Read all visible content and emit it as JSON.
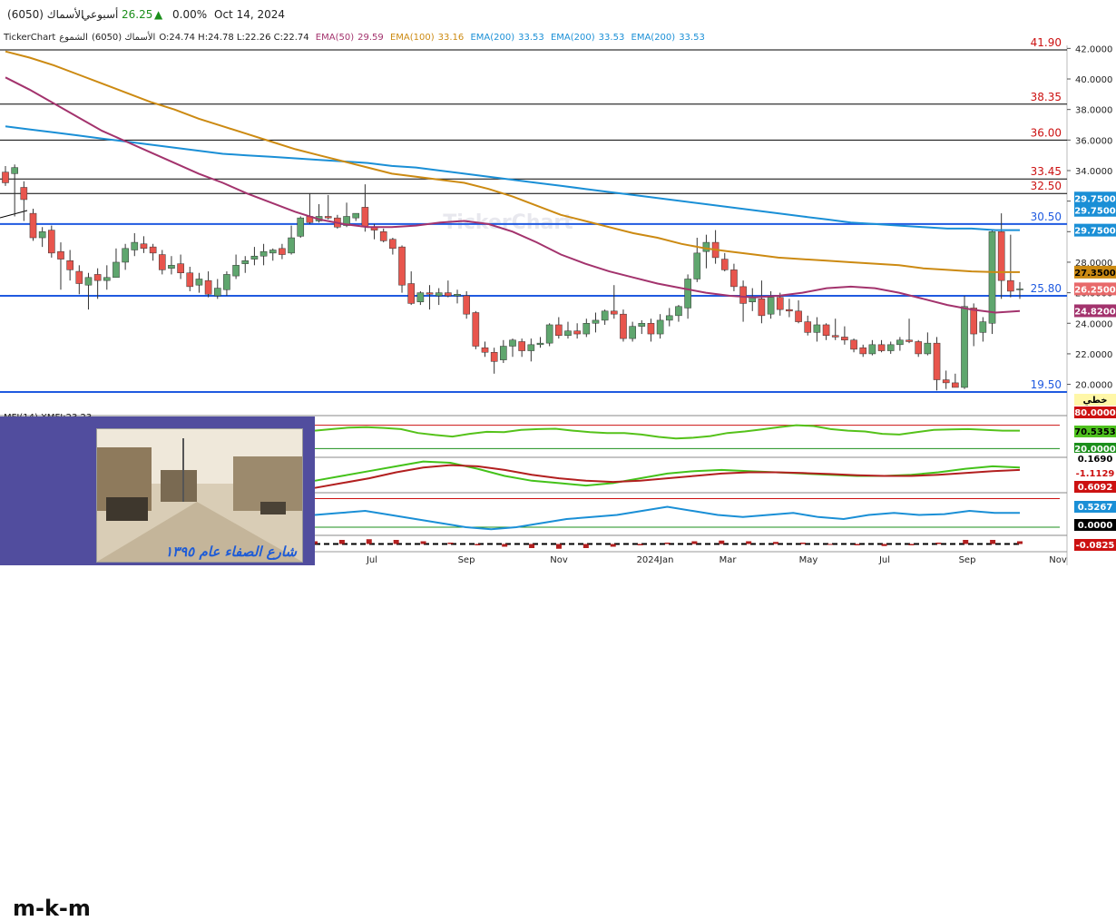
{
  "header": {
    "ticker": "الأسماك (6050)",
    "period": "أسبوعي",
    "price": "26.25",
    "change_pct": "0.00%",
    "date": "Oct 14, 2024"
  },
  "infoline": {
    "brand": "TickerChart",
    "name": "الأسماك (6050)",
    "kind": "الشموع",
    "ohlc": "O:24.74  H:24.78  L:22.26  C:22.74",
    "emas": [
      {
        "label": "EMA(50)",
        "value": "29.59",
        "color": "#a3336d"
      },
      {
        "label": "EMA(100)",
        "value": "33.16",
        "color": "#cc8a12"
      },
      {
        "label": "EMA(200)",
        "value": "33.53",
        "color": "#1a8fd6"
      },
      {
        "label": "EMA(200)",
        "value": "33.53",
        "color": "#1a8fd6"
      },
      {
        "label": "EMA(200)",
        "value": "33.53",
        "color": "#1a8fd6"
      }
    ]
  },
  "overlay": {
    "author": "m-k-m",
    "caption": "شارع الصفاء عام ١٣٩٥"
  },
  "chart_data": [
    {
      "type": "candlestick",
      "title": "الأسماك (6050)",
      "ylim": [
        19.5,
        42.2
      ],
      "y_ticks": [
        "42.0000",
        "40.0000",
        "38.0000",
        "36.0000",
        "34.0000",
        "32.0000",
        "30.0000",
        "28.0000",
        "26.0000",
        "24.0000",
        "22.0000",
        "20.0000"
      ],
      "x_ticks": [
        "Jul",
        "Sep",
        "Nov",
        "2024Jan",
        "Mar",
        "May",
        "Jul",
        "Sep",
        "Nov"
      ],
      "horizontal_levels": [
        {
          "value": 41.9,
          "label": "41.90",
          "color": "#000000",
          "label_color": "#cc1111"
        },
        {
          "value": 38.35,
          "label": "38.35",
          "color": "#000000",
          "label_color": "#cc1111"
        },
        {
          "value": 36.0,
          "label": "36.00",
          "color": "#000000",
          "label_color": "#cc1111"
        },
        {
          "value": 33.45,
          "label": "33.45",
          "color": "#000000",
          "label_color": "#cc1111"
        },
        {
          "value": 32.5,
          "label": "32.50",
          "color": "#000000",
          "label_color": "#cc1111"
        },
        {
          "value": 30.5,
          "label": "30.50",
          "color": "#1f5ae0",
          "label_color": "#1f5ae0"
        },
        {
          "value": 25.8,
          "label": "25.80",
          "color": "#1f5ae0",
          "label_color": "#1f5ae0"
        },
        {
          "value": 19.5,
          "label": "19.50",
          "color": "#1f5ae0",
          "label_color": "#1f5ae0"
        }
      ],
      "price_tags": [
        {
          "value": 32.2,
          "label": "29.7500",
          "bg": "#1a8fd6",
          "fg": "#ffffff"
        },
        {
          "value": 31.4,
          "label": "29.7500",
          "bg": "#1a8fd6",
          "fg": "#ffffff"
        },
        {
          "value": 30.1,
          "label": "29.7500",
          "bg": "#1a8fd6",
          "fg": "#ffffff"
        },
        {
          "value": 27.35,
          "label": "27.3500",
          "bg": "#cc8a12",
          "fg": "#000000"
        },
        {
          "value": 26.25,
          "label": "26.2500",
          "bg": "#e8696a",
          "fg": "#ffffff"
        },
        {
          "value": 24.82,
          "label": "24.8200",
          "bg": "#a3336d",
          "fg": "#ffffff"
        }
      ],
      "candles": [
        [
          33.9,
          34.3,
          33.0,
          33.2
        ],
        [
          33.8,
          34.4,
          31.0,
          34.2
        ],
        [
          32.9,
          33.3,
          30.7,
          32.1
        ],
        [
          31.2,
          31.5,
          29.4,
          29.6
        ],
        [
          29.6,
          30.3,
          29.0,
          30.0
        ],
        [
          30.1,
          30.4,
          28.3,
          28.6
        ],
        [
          28.7,
          29.3,
          26.2,
          28.2
        ],
        [
          28.1,
          28.8,
          26.8,
          27.5
        ],
        [
          27.4,
          27.8,
          25.9,
          26.6
        ],
        [
          26.5,
          27.3,
          24.9,
          27.0
        ],
        [
          27.2,
          27.6,
          25.6,
          26.8
        ],
        [
          26.8,
          27.8,
          26.2,
          27.0
        ],
        [
          27.0,
          28.9,
          27.0,
          28.0
        ],
        [
          28.0,
          29.2,
          27.5,
          28.9
        ],
        [
          28.8,
          29.9,
          28.4,
          29.3
        ],
        [
          29.2,
          29.7,
          28.6,
          28.9
        ],
        [
          29.0,
          29.2,
          28.1,
          28.6
        ],
        [
          28.5,
          28.8,
          27.2,
          27.5
        ],
        [
          27.6,
          28.4,
          27.2,
          27.8
        ],
        [
          27.9,
          28.5,
          26.9,
          27.3
        ],
        [
          27.3,
          27.7,
          26.1,
          26.4
        ],
        [
          26.5,
          27.3,
          26.0,
          26.9
        ],
        [
          26.8,
          27.4,
          25.7,
          25.9
        ],
        [
          25.8,
          26.9,
          25.6,
          26.3
        ],
        [
          26.2,
          27.4,
          25.8,
          27.2
        ],
        [
          27.1,
          28.5,
          26.9,
          27.8
        ],
        [
          27.9,
          28.4,
          27.3,
          28.1
        ],
        [
          28.2,
          29.0,
          27.8,
          28.4
        ],
        [
          28.4,
          29.2,
          27.8,
          28.7
        ],
        [
          28.6,
          28.9,
          28.1,
          28.8
        ],
        [
          28.9,
          29.2,
          28.2,
          28.5
        ],
        [
          28.6,
          30.4,
          28.5,
          29.6
        ],
        [
          29.7,
          31.0,
          29.6,
          30.9
        ],
        [
          31.0,
          32.5,
          30.5,
          30.6
        ],
        [
          30.7,
          31.8,
          30.6,
          31.0
        ],
        [
          31.0,
          32.4,
          30.8,
          30.9
        ],
        [
          30.9,
          31.1,
          30.2,
          30.3
        ],
        [
          30.4,
          31.9,
          30.3,
          31.0
        ],
        [
          30.9,
          31.2,
          30.7,
          31.2
        ],
        [
          31.6,
          33.1,
          30.0,
          30.3
        ],
        [
          30.3,
          30.5,
          29.5,
          30.1
        ],
        [
          30.0,
          30.2,
          29.3,
          29.4
        ],
        [
          29.5,
          29.6,
          28.5,
          28.9
        ],
        [
          29.0,
          29.1,
          26.0,
          26.5
        ],
        [
          26.6,
          27.4,
          25.2,
          25.3
        ],
        [
          25.4,
          26.1,
          25.2,
          26.0
        ],
        [
          26.0,
          26.5,
          24.9,
          25.9
        ],
        [
          25.8,
          26.3,
          25.2,
          26.0
        ],
        [
          26.0,
          26.8,
          25.7,
          25.8
        ],
        [
          25.8,
          26.2,
          25.3,
          25.9
        ],
        [
          25.8,
          26.1,
          24.3,
          24.6
        ],
        [
          24.7,
          24.8,
          22.3,
          22.5
        ],
        [
          22.4,
          22.8,
          21.8,
          22.1
        ],
        [
          22.1,
          22.4,
          20.7,
          21.5
        ],
        [
          21.6,
          22.9,
          21.4,
          22.5
        ],
        [
          22.5,
          23.0,
          21.8,
          22.9
        ],
        [
          22.8,
          23.0,
          21.8,
          22.2
        ],
        [
          22.2,
          23.0,
          21.5,
          22.6
        ],
        [
          22.6,
          23.1,
          22.4,
          22.7
        ],
        [
          22.7,
          24.0,
          22.5,
          23.9
        ],
        [
          23.9,
          24.4,
          23.0,
          23.2
        ],
        [
          23.2,
          24.1,
          23.0,
          23.5
        ],
        [
          23.5,
          24.0,
          23.0,
          23.3
        ],
        [
          23.3,
          24.3,
          23.1,
          24.0
        ],
        [
          24.0,
          24.7,
          23.4,
          24.2
        ],
        [
          24.2,
          24.9,
          23.9,
          24.8
        ],
        [
          24.8,
          26.5,
          24.3,
          24.6
        ],
        [
          24.6,
          24.9,
          22.8,
          23.0
        ],
        [
          23.0,
          24.1,
          22.8,
          23.8
        ],
        [
          23.8,
          24.2,
          23.3,
          24.0
        ],
        [
          24.0,
          24.3,
          22.8,
          23.3
        ],
        [
          23.3,
          24.6,
          23.0,
          24.2
        ],
        [
          24.2,
          25.0,
          23.8,
          24.5
        ],
        [
          24.5,
          25.2,
          24.1,
          25.1
        ],
        [
          25.0,
          27.2,
          24.3,
          26.9
        ],
        [
          26.9,
          29.6,
          26.7,
          28.6
        ],
        [
          28.7,
          29.8,
          27.6,
          29.3
        ],
        [
          29.3,
          30.1,
          27.9,
          28.3
        ],
        [
          28.2,
          28.6,
          27.4,
          27.5
        ],
        [
          27.5,
          27.9,
          26.1,
          26.4
        ],
        [
          26.4,
          26.8,
          24.1,
          25.3
        ],
        [
          25.4,
          26.3,
          24.8,
          25.7
        ],
        [
          25.6,
          26.8,
          24.0,
          24.5
        ],
        [
          24.6,
          26.1,
          24.3,
          25.7
        ],
        [
          25.7,
          26.0,
          24.5,
          24.9
        ],
        [
          24.9,
          25.6,
          24.4,
          24.8
        ],
        [
          24.8,
          25.5,
          24.0,
          24.1
        ],
        [
          24.1,
          24.5,
          23.2,
          23.4
        ],
        [
          23.4,
          24.4,
          22.8,
          23.9
        ],
        [
          23.9,
          24.0,
          22.9,
          23.2
        ],
        [
          23.2,
          24.3,
          22.9,
          23.1
        ],
        [
          23.1,
          23.8,
          22.6,
          22.9
        ],
        [
          22.9,
          23.0,
          22.1,
          22.3
        ],
        [
          22.4,
          22.6,
          21.8,
          22.0
        ],
        [
          22.0,
          22.9,
          21.9,
          22.6
        ],
        [
          22.6,
          22.9,
          22.1,
          22.2
        ],
        [
          22.2,
          22.8,
          22.0,
          22.6
        ],
        [
          22.6,
          23.1,
          22.2,
          22.9
        ],
        [
          22.9,
          24.3,
          22.7,
          22.8
        ],
        [
          22.8,
          22.9,
          21.8,
          22.0
        ],
        [
          22.0,
          23.4,
          21.9,
          22.7
        ],
        [
          22.7,
          23.1,
          19.6,
          20.3
        ],
        [
          20.3,
          20.9,
          19.7,
          20.1
        ],
        [
          20.1,
          20.7,
          19.8,
          19.8
        ],
        [
          19.8,
          25.8,
          19.7,
          25.1
        ],
        [
          25.0,
          25.3,
          22.5,
          23.3
        ],
        [
          23.4,
          24.4,
          22.8,
          24.1
        ],
        [
          24.0,
          30.1,
          23.3,
          30.0
        ],
        [
          30.0,
          31.2,
          25.6,
          26.8
        ],
        [
          26.8,
          29.8,
          25.7,
          26.1
        ],
        [
          26.2,
          26.7,
          25.6,
          26.25
        ]
      ],
      "ema50": [
        40.1,
        39.3,
        38.4,
        37.5,
        36.6,
        35.9,
        35.2,
        34.5,
        33.8,
        33.2,
        32.5,
        31.9,
        31.3,
        30.8,
        30.5,
        30.3,
        30.3,
        30.4,
        30.6,
        30.7,
        30.5,
        30.0,
        29.3,
        28.5,
        27.9,
        27.4,
        27.0,
        26.6,
        26.3,
        26.0,
        25.8,
        25.7,
        25.8,
        26.0,
        26.3,
        26.4,
        26.3,
        26.0,
        25.6,
        25.2,
        24.9,
        24.7,
        24.8
      ],
      "ema100": [
        41.8,
        41.4,
        40.9,
        40.3,
        39.7,
        39.1,
        38.5,
        38.0,
        37.4,
        36.9,
        36.4,
        35.9,
        35.4,
        35.0,
        34.6,
        34.2,
        33.8,
        33.6,
        33.4,
        33.2,
        32.8,
        32.3,
        31.7,
        31.1,
        30.7,
        30.3,
        29.9,
        29.6,
        29.2,
        28.9,
        28.7,
        28.5,
        28.3,
        28.2,
        28.1,
        28.0,
        27.9,
        27.8,
        27.6,
        27.5,
        27.4,
        27.35,
        27.35
      ],
      "ema200": [
        36.9,
        36.7,
        36.5,
        36.3,
        36.1,
        35.9,
        35.7,
        35.5,
        35.3,
        35.1,
        35.0,
        34.9,
        34.8,
        34.7,
        34.6,
        34.5,
        34.3,
        34.2,
        34.0,
        33.8,
        33.6,
        33.4,
        33.2,
        33.0,
        32.8,
        32.6,
        32.4,
        32.2,
        32.0,
        31.8,
        31.6,
        31.4,
        31.2,
        31.0,
        30.8,
        30.6,
        30.5,
        30.4,
        30.3,
        30.2,
        30.2,
        30.1,
        30.1
      ]
    },
    {
      "type": "line",
      "title": "MFI(14)  XMFI:23.23",
      "y_tags": [
        {
          "label": "خطي",
          "bg": "#fff7a8",
          "fg": "#000000"
        },
        {
          "label": "80.0000",
          "bg": "#cc1111",
          "fg": "#ffffff"
        },
        {
          "label": "70.5353",
          "bg": "#4fc21e",
          "fg": "#000000"
        },
        {
          "label": "20.0000",
          "bg": "#1b8f1b",
          "fg": "#ffffff"
        },
        {
          "label": "0.1690",
          "bg": "#ffffff",
          "fg": "#000000"
        }
      ],
      "series": [
        {
          "values": [
            66,
            70,
            74,
            75,
            73,
            70,
            60,
            55,
            51,
            58,
            63,
            62,
            68,
            70,
            71,
            66,
            62,
            60,
            60,
            56,
            50,
            46,
            48,
            52,
            60,
            64,
            69,
            75,
            80,
            78,
            70,
            66,
            64,
            58,
            56,
            62,
            68,
            69,
            70,
            68,
            66,
            66
          ]
        }
      ]
    },
    {
      "type": "line",
      "y_tags": [
        {
          "label": "-1.1129",
          "bg": "#ffffff",
          "fg": "#cc1111"
        },
        {
          "label": "0.6092",
          "bg": "#cc1111",
          "fg": "#ffffff"
        }
      ],
      "series": [
        {
          "values": [
            0.1,
            0.3,
            0.5,
            0.7,
            0.9,
            0.85,
            0.6,
            0.3,
            0.1,
            0.0,
            -0.1,
            0.0,
            0.2,
            0.4,
            0.5,
            0.55,
            0.5,
            0.45,
            0.4,
            0.35,
            0.3,
            0.3,
            0.35,
            0.45,
            0.6,
            0.7,
            0.65
          ]
        },
        {
          "values": [
            -0.2,
            0.0,
            0.2,
            0.45,
            0.65,
            0.75,
            0.7,
            0.55,
            0.35,
            0.2,
            0.1,
            0.05,
            0.1,
            0.2,
            0.3,
            0.4,
            0.45,
            0.45,
            0.42,
            0.38,
            0.33,
            0.3,
            0.3,
            0.35,
            0.42,
            0.5,
            0.55
          ]
        }
      ]
    },
    {
      "type": "line",
      "y_tags": [
        {
          "label": "0.5267",
          "bg": "#1a8fd6",
          "fg": "#ffffff"
        },
        {
          "label": "0.0000",
          "bg": "#000000",
          "fg": "#ffffff"
        }
      ],
      "series": [
        {
          "values": [
            0.5,
            0.55,
            0.6,
            0.5,
            0.4,
            0.3,
            0.2,
            0.15,
            0.2,
            0.3,
            0.4,
            0.45,
            0.5,
            0.6,
            0.7,
            0.6,
            0.5,
            0.45,
            0.5,
            0.55,
            0.45,
            0.4,
            0.5,
            0.55,
            0.5,
            0.52,
            0.6,
            0.55,
            0.55
          ]
        }
      ]
    },
    {
      "type": "bar",
      "y_tags": [
        {
          "label": "-0.0825",
          "bg": "#cc1111",
          "fg": "#ffffff"
        }
      ],
      "values": [
        0.2,
        0.3,
        0.35,
        0.3,
        0.2,
        0.1,
        -0.1,
        -0.2,
        -0.3,
        -0.35,
        -0.3,
        -0.2,
        -0.1,
        0.1,
        0.2,
        0.25,
        0.2,
        0.15,
        0.1,
        0.0,
        -0.1,
        -0.15,
        -0.1,
        0.1,
        0.3,
        0.3,
        0.2
      ]
    }
  ]
}
